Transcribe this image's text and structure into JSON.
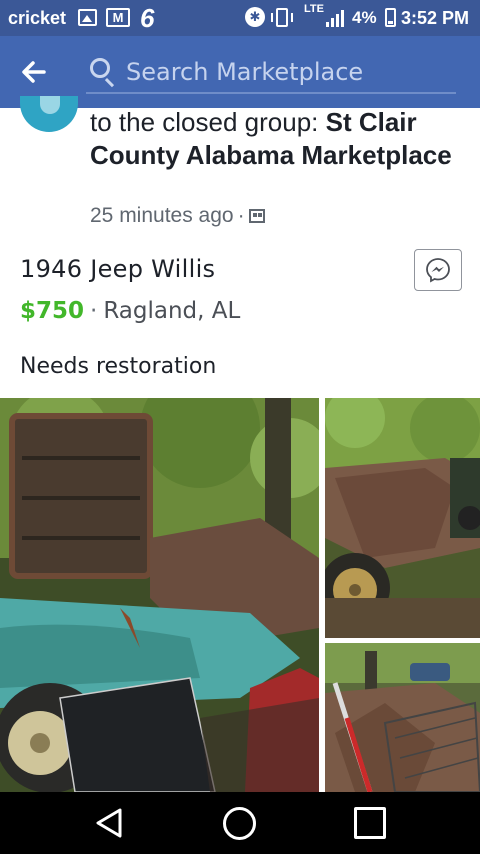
{
  "status_bar": {
    "carrier": "cricket",
    "notification_count": "6",
    "network": "LTE",
    "battery_percent": "4%",
    "time": "3:52 PM"
  },
  "app_bar": {
    "back_icon": "arrow-left-icon",
    "search_placeholder": "Search Marketplace",
    "background_color": "#4267b2"
  },
  "post": {
    "header_prefix": "to the closed group: ",
    "group_name": "St Clair County Alabama Marketplace",
    "time_ago": "25 minutes ago",
    "separator": "·",
    "privacy_icon": "group-privacy-icon"
  },
  "listing": {
    "title": "1946 Jeep Willis",
    "price": "$750",
    "price_color": "#42b72a",
    "separator": "·",
    "location": "Ragland, AL",
    "description": "Needs restoration",
    "message_icon": "messenger-icon"
  },
  "photos": [
    "photo-main",
    "photo-top-right",
    "photo-bottom-right"
  ],
  "nav_bar": {
    "back_icon": "triangle-back-icon",
    "home_icon": "circle-home-icon",
    "recents_icon": "square-recents-icon"
  }
}
